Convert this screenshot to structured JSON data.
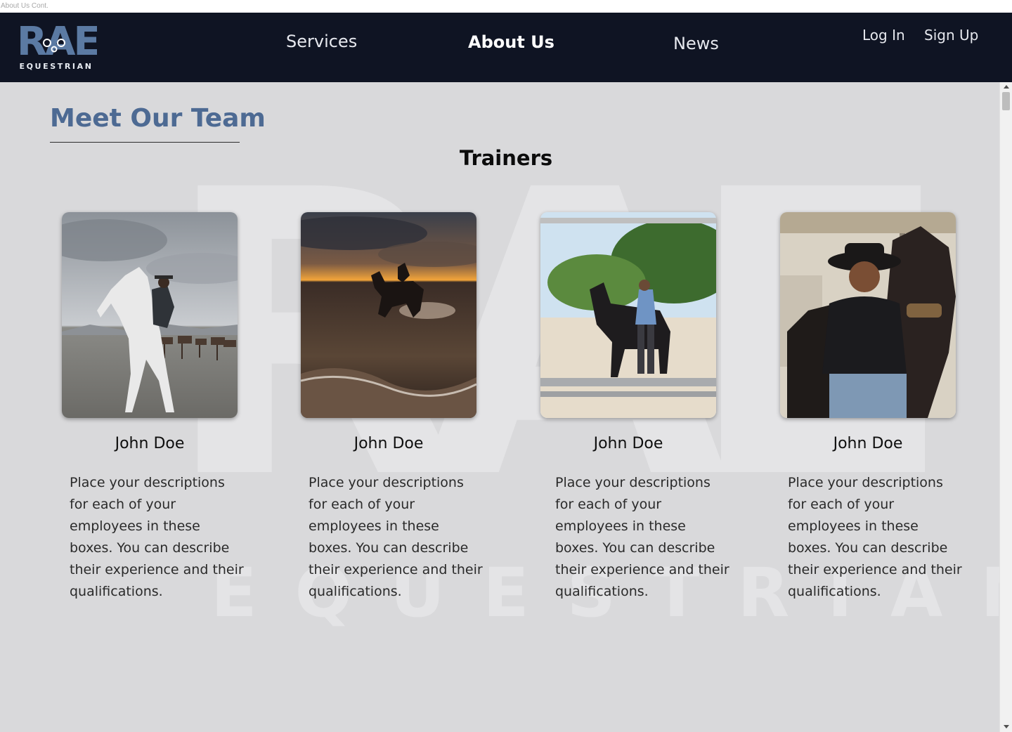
{
  "window": {
    "caption": "About Us Cont."
  },
  "brand": {
    "logo_text": "RAE",
    "logo_subtitle": "EQUESTRIAN",
    "logo_color": "#5b7aa3"
  },
  "nav": {
    "links": [
      {
        "label": "Services"
      },
      {
        "label": "About Us",
        "active": true
      },
      {
        "label": "News"
      }
    ],
    "auth": {
      "login": "Log In",
      "signup": "Sign Up"
    }
  },
  "page": {
    "title": "Meet Our Team",
    "subheading": "Trainers",
    "watermark_text": {
      "main": "RAE",
      "sub": "EQUESTRIAN"
    },
    "team": [
      {
        "name": "John Doe",
        "description": "Place your descriptions for each of your employees in these boxes. You can describe their experience and their qualifications.",
        "photo": "rearing-white-horse-with-rider"
      },
      {
        "name": "John Doe",
        "description": "Place your descriptions for each of your employees in these boxes. You can describe their experience and their qualifications.",
        "photo": "horse-rider-in-surf-at-sunset"
      },
      {
        "name": "John Doe",
        "description": "Place your descriptions for each of your employees in these boxes. You can describe their experience and their qualifications.",
        "photo": "woman-leading-black-horse-in-arena"
      },
      {
        "name": "John Doe",
        "description": "Place your descriptions for each of your employees in these boxes. You can describe their experience and their qualifications.",
        "photo": "smiling-man-in-cowboy-hat-with-horse"
      }
    ]
  },
  "colors": {
    "navbar_bg": "#0f1423",
    "content_bg": "#d9d9db",
    "title_color": "#4d6a93"
  }
}
